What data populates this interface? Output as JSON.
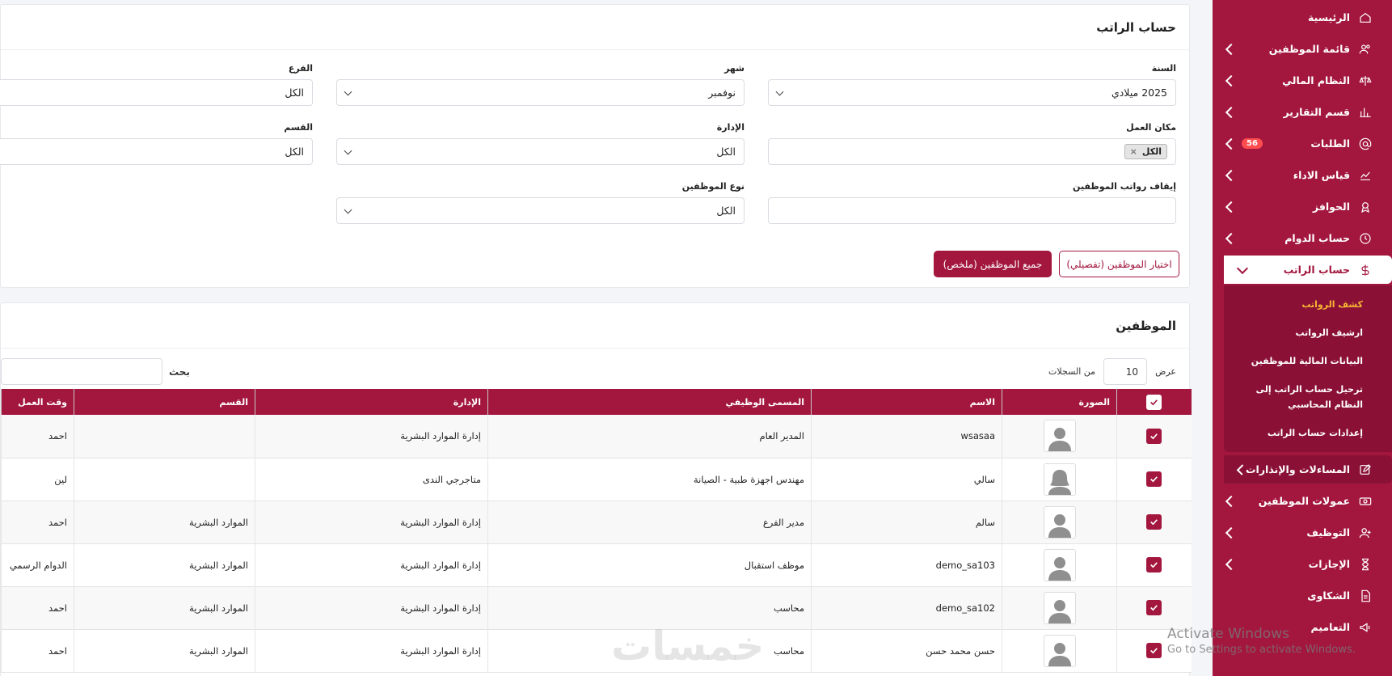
{
  "sidebar": {
    "items": [
      {
        "label": "الرئيسية",
        "icon": "home-icon",
        "chevron": false
      },
      {
        "label": "قائمة الموظفين",
        "icon": "users-icon",
        "chevron": true
      },
      {
        "label": "النظام المالي",
        "icon": "scale-icon",
        "chevron": true
      },
      {
        "label": "قسم التقارير",
        "icon": "bar-chart-icon",
        "chevron": true
      },
      {
        "label": "الطلبات",
        "icon": "at-icon",
        "chevron": true,
        "badge": "56"
      },
      {
        "label": "قياس الاداء",
        "icon": "line-chart-icon",
        "chevron": true
      },
      {
        "label": "الحوافز",
        "icon": "award-icon",
        "chevron": true
      },
      {
        "label": "حساب الدوام",
        "icon": "clock-icon",
        "chevron": true
      },
      {
        "label": "حساب الراتب",
        "icon": "dollar-icon",
        "chevron": true,
        "active": true
      }
    ],
    "subitems": [
      {
        "label": "كشف الرواتب",
        "current": true
      },
      {
        "label": "ارشيف الرواتب"
      },
      {
        "label": "البيانات المالية للموظفين"
      },
      {
        "label": "ترحيل حساب الراتب إلى النظام المحاسبي"
      },
      {
        "label": "إعدادات حساب الراتب"
      }
    ],
    "items_after": [
      {
        "label": "المساءلات والإنذارات",
        "icon": "edit-icon",
        "chevron": true,
        "darker": true
      },
      {
        "label": "عمولات الموظفين",
        "icon": "money-icon",
        "chevron": true
      },
      {
        "label": "التوظيف",
        "icon": "user-plus-icon",
        "chevron": true
      },
      {
        "label": "الإجازات",
        "icon": "hourglass-icon",
        "chevron": true
      },
      {
        "label": "الشكاوى",
        "icon": "document-icon",
        "chevron": false
      },
      {
        "label": "التعاميم",
        "icon": "megaphone-icon",
        "chevron": false
      }
    ]
  },
  "salary_card": {
    "title": "حساب الراتب",
    "fields": {
      "year": {
        "label": "السنة",
        "value": "2025 ميلادي"
      },
      "month": {
        "label": "شهر",
        "value": "نوفمبر"
      },
      "branch": {
        "label": "الفرع",
        "value": "الكل"
      },
      "workplace": {
        "label": "مكان العمل",
        "tag": "الكل",
        "tag_remove": "×"
      },
      "administration": {
        "label": "الإدارة",
        "value": "الكل"
      },
      "department": {
        "label": "القسم",
        "value": "الكل"
      },
      "stop_salaries": {
        "label": "إيقاف رواتب الموظفين",
        "value": ""
      },
      "employee_type": {
        "label": "نوع الموظفين",
        "value": "الكل"
      }
    },
    "buttons": {
      "select_detailed": "اختيار الموظفين (تفصيلي)",
      "all_summary": "جميع الموظفين (ملخص)"
    }
  },
  "employees_card": {
    "title": "الموظفين",
    "length": {
      "prefix": "عرض",
      "value": "10",
      "suffix": "من السجلات"
    },
    "search_label": "بحث",
    "columns": [
      "",
      "الصورة",
      "الاسم",
      "المسمى الوظيفي",
      "الإدارة",
      "القسم",
      "وقت العمل"
    ],
    "rows": [
      {
        "name": "wsasaa",
        "title": "المدير العام",
        "admin": "إدارة الموارد البشرية",
        "dept": "",
        "worktime": "احمد",
        "avatar": "male"
      },
      {
        "name": "سالي",
        "title": "مهندس اجهزة طبية - الصيانة",
        "admin": "متاجرجي الندى",
        "dept": "",
        "worktime": "لين",
        "avatar": "female"
      },
      {
        "name": "سالم",
        "title": "مدير الفرع",
        "admin": "إدارة الموارد البشرية",
        "dept": "الموارد البشرية",
        "worktime": "احمد",
        "avatar": "male"
      },
      {
        "name": "demo_sa103",
        "title": "موظف استقبال",
        "admin": "إدارة الموارد البشرية",
        "dept": "الموارد البشرية",
        "worktime": "الدوام الرسمي",
        "avatar": "male"
      },
      {
        "name": "demo_sa102",
        "title": "محاسب",
        "admin": "إدارة الموارد البشرية",
        "dept": "الموارد البشرية",
        "worktime": "احمد",
        "avatar": "male"
      },
      {
        "name": "حسن محمد حسن",
        "title": "محاسب",
        "admin": "إدارة الموارد البشرية",
        "dept": "الموارد البشرية",
        "worktime": "احمد",
        "avatar": "male"
      }
    ]
  },
  "watermark": "خمسات",
  "activation": {
    "line1": "Activate Windows",
    "line2": "Go to Settings to activate Windows."
  },
  "colors": {
    "brand": "#a3173f",
    "brand_dark": "#8a1135",
    "current_sub": "#f7b733",
    "badge": "#ff4d4f"
  }
}
